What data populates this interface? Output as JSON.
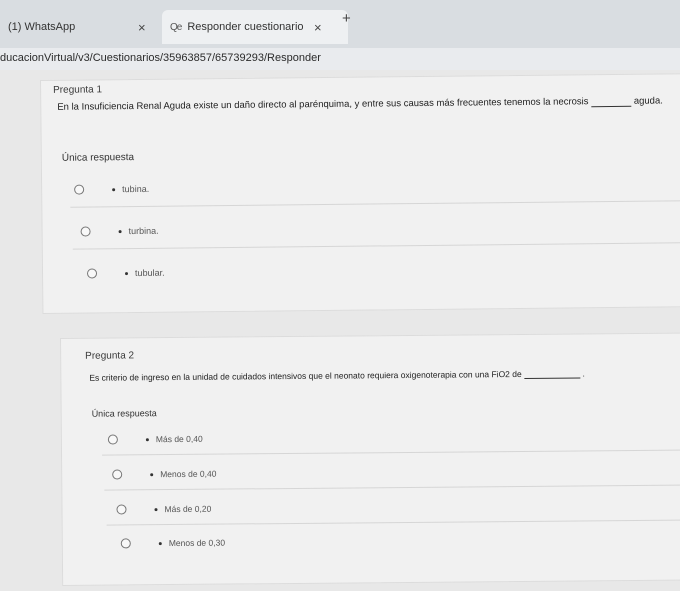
{
  "browser": {
    "tabs": [
      {
        "title": "(1) WhatsApp"
      },
      {
        "icon": "Qe",
        "title": "Responder cuestionario"
      }
    ],
    "close_glyph": "×",
    "new_tab_glyph": "+",
    "url": "ducacionVirtual/v3/Cuestionarios/35963857/65739293/Responder"
  },
  "questions": [
    {
      "number": "Pregunta 1",
      "text_before": "En la Insuficiencia Renal Aguda existe un daño directo al parénquima, y entre sus causas más frecuentes tenemos la necrosis",
      "text_after": "aguda.",
      "type_label": "Única respuesta",
      "options": [
        "tubina.",
        "turbina.",
        "tubular."
      ]
    },
    {
      "number": "Pregunta 2",
      "text_before": "Es criterio de ingreso en la unidad de cuidados intensivos que el neonato requiera oxigenoterapia con una FiO2 de",
      "text_after": ".",
      "type_label": "Única respuesta",
      "options": [
        "Más de 0,40",
        "Menos de 0,40",
        "Más de 0,20",
        "Menos de 0,30"
      ]
    }
  ]
}
